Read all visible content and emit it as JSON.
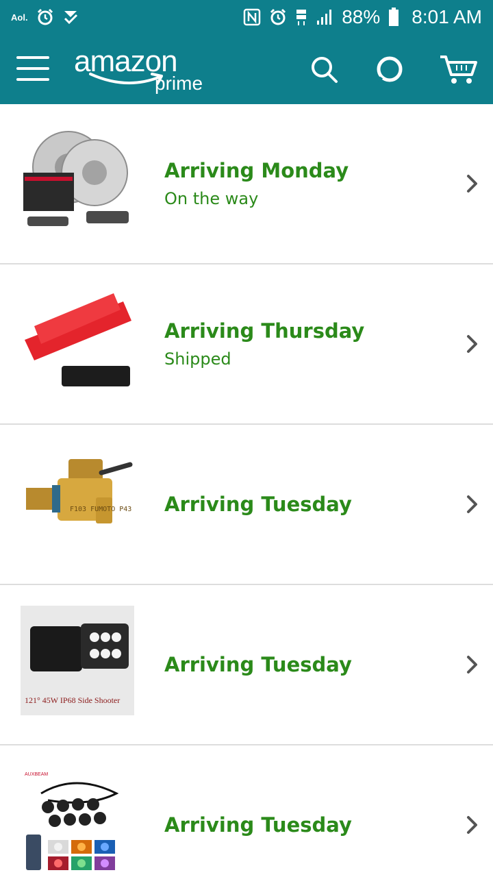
{
  "status_bar": {
    "carrier": "Aol.",
    "battery": "88%",
    "time": "8:01 AM",
    "icons": [
      "alarm-icon",
      "check-icon",
      "nfc-icon",
      "alarm-icon",
      "4g-lte-icon",
      "signal-icon",
      "battery-icon"
    ]
  },
  "app_bar": {
    "logo_text": "amazon",
    "logo_sub": "prime",
    "icons": [
      "menu-icon",
      "search-icon",
      "alexa-icon",
      "cart-icon"
    ]
  },
  "orders": [
    {
      "title": "Arriving Monday",
      "subtitle": "On the way",
      "image": "brake-kit-product"
    },
    {
      "title": "Arriving Thursday",
      "subtitle": "Shipped",
      "image": "traction-boards-product"
    },
    {
      "title": "Arriving Tuesday",
      "subtitle": "",
      "image": "oil-drain-valve-product",
      "image_text": "F103 FUMOTO P43"
    },
    {
      "title": "Arriving Tuesday",
      "subtitle": "",
      "image": "side-shooter-light-product",
      "image_text": "121° 45W IP68 Side Shooter"
    },
    {
      "title": "Arriving Tuesday",
      "subtitle": "",
      "image": "rock-lights-product",
      "image_text": "AUXBEAM"
    }
  ],
  "colors": {
    "header": "#0e7f8c",
    "status_green": "#2b8a1a",
    "divider": "#dddddd",
    "chevron": "#555555"
  }
}
